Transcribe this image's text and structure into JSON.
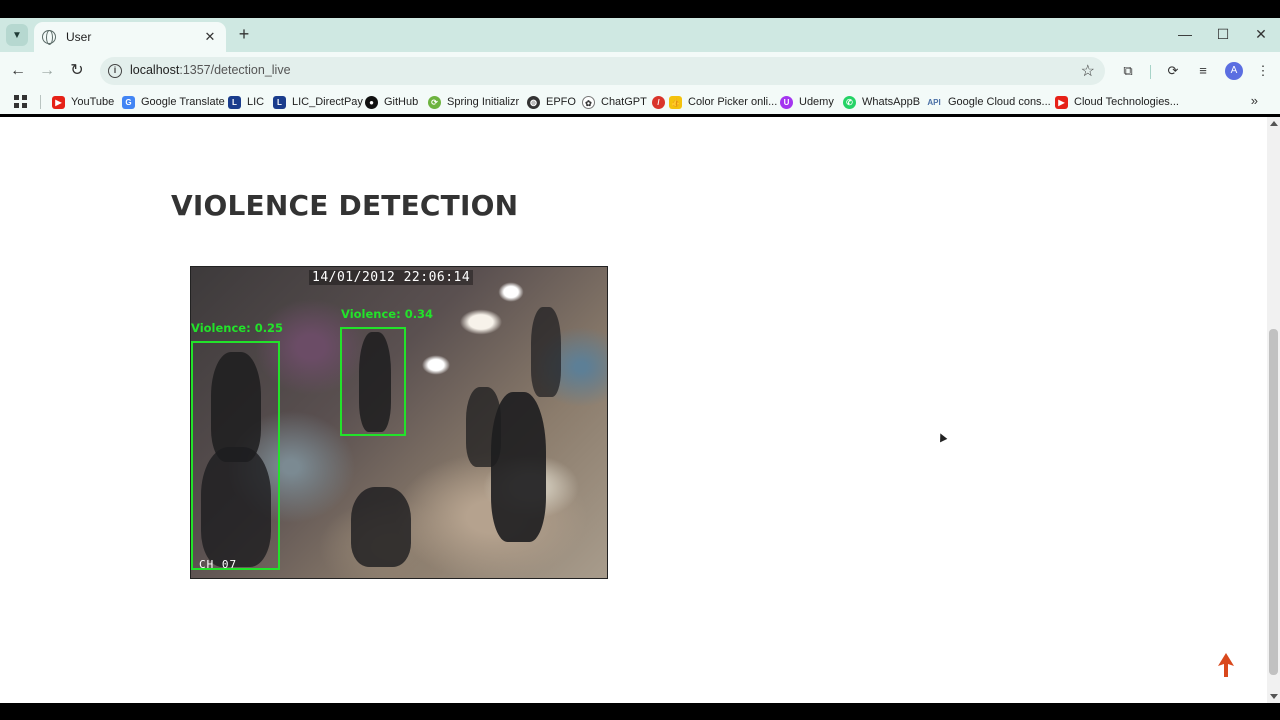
{
  "browser": {
    "tab_title": "User",
    "url_host": "localhost",
    "url_path": ":1357/detection_live",
    "avatar_letter": "A",
    "bookmarks": [
      {
        "label": "YouTube",
        "icon": "youtube-icon",
        "color": "#e62117"
      },
      {
        "label": "Google Translate",
        "icon": "translate-icon",
        "color": "#4285f4"
      },
      {
        "label": "LIC",
        "icon": "lic-icon",
        "color": "#1a3c8c"
      },
      {
        "label": "LIC_DirectPay",
        "icon": "lic-icon",
        "color": "#1a3c8c"
      },
      {
        "label": "GitHub",
        "icon": "github-icon",
        "color": "#111111"
      },
      {
        "label": "Spring Initializr",
        "icon": "spring-icon",
        "color": "#6db33f"
      },
      {
        "label": "EPFO",
        "icon": "globe-icon",
        "color": "#333333"
      },
      {
        "label": "ChatGPT",
        "icon": "chatgpt-icon",
        "color": "#333333"
      },
      {
        "label": "Color Picker onli...",
        "icon": "color-picker-icon",
        "color": "#d9342b"
      },
      {
        "label": "Udemy",
        "icon": "udemy-icon",
        "color": "#a435f0"
      },
      {
        "label": "WhatsAppB",
        "icon": "whatsapp-icon",
        "color": "#25d366"
      },
      {
        "label": "Google Cloud cons...",
        "icon": "api-icon",
        "color": "#4a6fa5"
      },
      {
        "label": "Cloud Technologies...",
        "icon": "youtube-icon",
        "color": "#e62117"
      }
    ]
  },
  "page": {
    "title": "VIOLENCE DETECTION",
    "feed": {
      "timestamp": "14/01/2012 22:06:14",
      "channel": "CH 07",
      "detections": [
        {
          "label": "Violence: 0.25"
        },
        {
          "label": "Violence: 0.34"
        }
      ]
    }
  },
  "colors": {
    "detection_box": "#22e32a",
    "scroll_top_arrow": "#d9481c",
    "tabstrip": "#cfe8e2"
  }
}
